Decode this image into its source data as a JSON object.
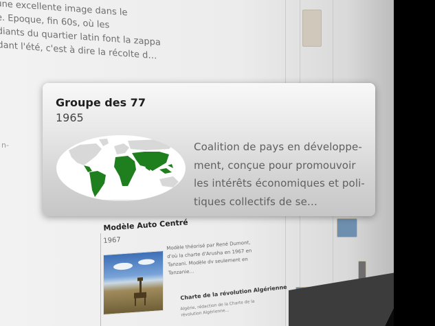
{
  "background": {
    "article_lines": [
      "une excellente image dans le",
      "e. Epoque, fin 60s, où les",
      "diants du quartier latin font la zappa",
      "dant l'été, c'est à dire la récolte d…"
    ],
    "left_fragment": "n-"
  },
  "popup": {
    "title": "Groupe des 77",
    "year": "1965",
    "description_lines": [
      "Coalition de pays en développe-",
      "ment, conçue pour promouvoir",
      "les intérêts économiques et poli-",
      "tiques collectifs de se…"
    ]
  },
  "card_modele": {
    "title": "Modèle Auto Centré",
    "year": "1967",
    "text": "Modèle théorisé par René Dumont, d'où la charte d'Arusha en 1967 en Tanzani. Modèle dv seulement en Tanzanie…"
  },
  "card_charte": {
    "title": "Charte de la révolution Algérienne",
    "text": "Algérie, rédaction de la Charte de la révolution Algérienne…"
  },
  "colors": {
    "map_land": "#1f7f1f",
    "map_other": "#d8d8d8",
    "popup_title": "#1f1f1f",
    "popup_text": "#5f5f5f"
  }
}
